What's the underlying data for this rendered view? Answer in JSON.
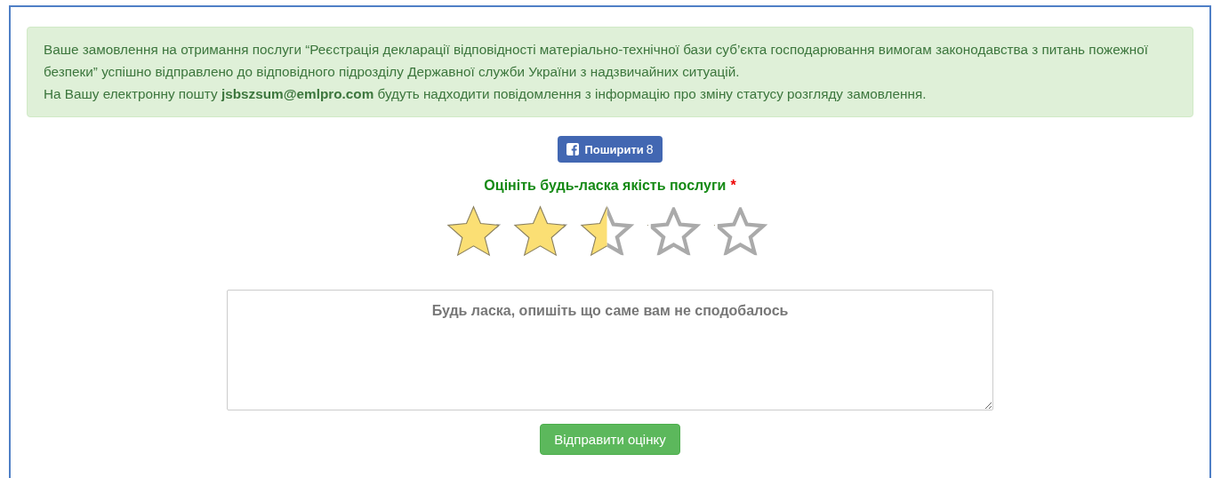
{
  "alert": {
    "paragraphs": [
      "Ваше замовлення на отримання послуги “Реєстрація декларації відповідності матеріально-технічної бази суб’єкта господарювання вимогам законодавства з питань пожежної безпеки” успішно відправлено до відповідного підрозділу Державної служби України з надзвичайних ситуацій.",
      "На Вашу електронну пошту **jsbszsum@emlpro.com** будуть надходити повідомлення з інформацію про зміну статусу розгляду замовлення."
    ]
  },
  "share": {
    "label": "Поширити",
    "count": "8"
  },
  "rating": {
    "label": "Оцініть будь-ласка якість послуги",
    "required_mark": "*",
    "stars": 2.5
  },
  "feedback": {
    "placeholder": "Будь ласка, опишіть що саме вам не сподобалось"
  },
  "submit": {
    "label": "Відправити оцінку"
  }
}
